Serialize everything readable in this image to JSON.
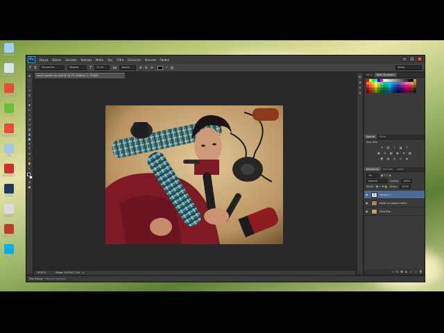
{
  "app": {
    "logo": "Ps",
    "menu": [
      "Dosya",
      "Düzen",
      "Görüntü",
      "Katman",
      "Metin",
      "Seç",
      "Filtre",
      "Görünüm",
      "Pencere",
      "Yardım"
    ],
    "workspace": "Temel"
  },
  "options": {
    "font_family": "Myriad Pro",
    "font_style": "Regular",
    "font_size": "12 nk",
    "aa_label": "aa",
    "antialias": "Keskin",
    "text_color": "#000000"
  },
  "document": {
    "tab_label": "serial yapilan son.psd @ 16,7% (Katman 1, RGB/8)",
    "zoom": "16,67%",
    "status": "Belge: 60,0M/77,0M",
    "timeline_label": "Mini Bridge",
    "timeline_tab2": "Zaman Çizelgesi"
  },
  "panels": {
    "color_tabs": [
      "Renk",
      "Renk Örnekleri"
    ],
    "adjust_tabs": [
      "Ayarlar",
      "Stiller"
    ],
    "adjust_label": "Ayar ekle",
    "layer_tabs": [
      "Katmanlar",
      "Kanallar",
      "Yollar"
    ],
    "kind_label": "Tür",
    "blend_mode": "Normal",
    "opacity_label": "Opaklık:",
    "opacity_value": "100%",
    "lock_label": "Kilitle:",
    "fill_label": "Dolgu:",
    "fill_value": "100%",
    "layers": [
      {
        "name": "Katman 1",
        "thumb": "T",
        "selected": true
      },
      {
        "name": "serial ve yapılan resim",
        "thumb": "",
        "selected": false
      },
      {
        "name": "Arka Plan",
        "thumb": "",
        "selected": false
      }
    ]
  },
  "desktop_icons": [
    {
      "label": "Bilgisayar",
      "color": "#9fd0ff"
    },
    {
      "label": "Geri Dönüşüm",
      "color": "#d6e4f2"
    },
    {
      "label": "Google Chrome",
      "color": "#e94b3c"
    },
    {
      "label": "uTorrent",
      "color": "#6bbf3a"
    },
    {
      "label": "Google Chrome",
      "color": "#e94b3c"
    },
    {
      "label": "Ağ",
      "color": "#9fc8e8"
    },
    {
      "label": "Biteldefer",
      "color": "#d22d2d"
    },
    {
      "label": "Steam",
      "color": "#1d3b5c"
    },
    {
      "label": "Belgeler",
      "color": "#dcdcdc"
    },
    {
      "label": "Dosyalar",
      "color": "#c0392b"
    },
    {
      "label": "Skype",
      "color": "#00aff0"
    }
  ],
  "colors": {
    "selection": "#4b6a94",
    "panel_bg": "#3a3a3a",
    "canvas_bg": "#282828",
    "accent_ps": "#2fa4e7"
  }
}
